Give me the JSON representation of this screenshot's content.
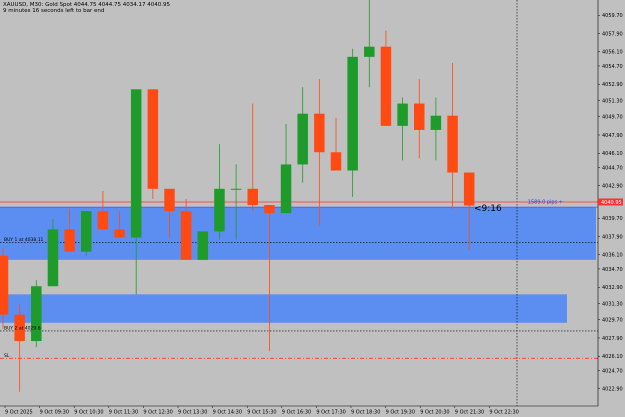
{
  "header": {
    "symbol_line": "XAUUSD, M30:  Gold Spot  4044.75  4044.75  4034.17  4040.95",
    "timer_line": "9 minutes 16 seconds left to bar end"
  },
  "colors": {
    "background": "#c0c0c0",
    "bull": "#1e9b2a",
    "bear": "#ff4a14",
    "zone": "#5b8ef0",
    "bid_line": "#ff3030",
    "blue_line": "#1e3cff",
    "grid": "#000000"
  },
  "price_axis": {
    "min": 4021.2,
    "max": 4061.2,
    "ticks": [
      "4059.70",
      "4056.10",
      "4052.90",
      "4049.70",
      "4046.10",
      "4042.90",
      "4039.70",
      "4036.10",
      "4032.90",
      "4029.70",
      "4026.10",
      "4022.90"
    ],
    "ticks_mid": [
      "4057.90",
      "4054.70",
      "4051.30",
      "4047.90",
      "4044.70",
      "4041.30",
      "4037.90",
      "4034.70",
      "4031.30",
      "4027.90",
      "4024.70"
    ]
  },
  "price_labels": [
    "4059.70",
    "4057.90",
    "4056.10",
    "4054.70",
    "4052.90",
    "4051.30",
    "4049.70",
    "4047.90",
    "4046.10",
    "4044.70",
    "4042.90",
    "4041.30",
    "4039.70",
    "4037.90",
    "4036.10",
    "4034.70",
    "4032.90",
    "4031.30",
    "4029.70",
    "4027.90",
    "4026.10",
    "4024.70",
    "4022.90"
  ],
  "time_axis": {
    "labels": [
      "9 Oct 2025",
      "9 Oct 09:30",
      "9 Oct 10:30",
      "9 Oct 11:30",
      "9 Oct 12:30",
      "9 Oct 13:30",
      "9 Oct 14:30",
      "9 Oct 15:30",
      "9 Oct 16:30",
      "9 Oct 17:30",
      "9 Oct 18:30",
      "9 Oct 19:30",
      "9 Oct 20:30",
      "9 Oct 21:30",
      "9 Oct 22:30"
    ]
  },
  "chart_data": {
    "type": "candlestick",
    "candles": [
      {
        "o": 4036.0,
        "h": 4036.8,
        "l": 4028.8,
        "c": 4030.2
      },
      {
        "o": 4030.2,
        "h": 4031.2,
        "l": 4022.6,
        "c": 4027.6
      },
      {
        "o": 4027.6,
        "h": 4033.6,
        "l": 4027.0,
        "c": 4033.0
      },
      {
        "o": 4033.0,
        "h": 4039.6,
        "l": 4033.0,
        "c": 4038.6
      },
      {
        "o": 4038.6,
        "h": 4040.6,
        "l": 4036.4,
        "c": 4036.4
      },
      {
        "o": 4036.4,
        "h": 4040.4,
        "l": 4036.0,
        "c": 4040.4
      },
      {
        "o": 4040.4,
        "h": 4042.4,
        "l": 4038.6,
        "c": 4038.6
      },
      {
        "o": 4038.6,
        "h": 4040.4,
        "l": 4037.8,
        "c": 4037.8
      },
      {
        "o": 4037.8,
        "h": 4048.6,
        "l": 4032.2,
        "c": 4052.4
      },
      {
        "o": 4052.4,
        "h": 4052.4,
        "l": 4041.6,
        "c": 4042.6
      },
      {
        "o": 4042.6,
        "h": 4042.6,
        "l": 4037.8,
        "c": 4040.4
      },
      {
        "o": 4040.4,
        "h": 4041.6,
        "l": 4035.6,
        "c": 4035.6
      },
      {
        "o": 4035.6,
        "h": 4035.6,
        "l": 4035.6,
        "c": 4038.4
      },
      {
        "o": 4038.4,
        "h": 4047.0,
        "l": 4037.6,
        "c": 4042.6
      },
      {
        "o": 4042.6,
        "h": 4045.0,
        "l": 4037.6,
        "c": 4042.6
      },
      {
        "o": 4042.6,
        "h": 4051.0,
        "l": 4040.4,
        "c": 4041.0
      },
      {
        "o": 4041.0,
        "h": 4041.0,
        "l": 4026.6,
        "c": 4040.2
      },
      {
        "o": 4040.2,
        "h": 4049.0,
        "l": 4040.2,
        "c": 4045.0
      },
      {
        "o": 4045.0,
        "h": 4052.6,
        "l": 4043.2,
        "c": 4050.0
      },
      {
        "o": 4050.0,
        "h": 4053.4,
        "l": 4039.0,
        "c": 4046.2
      },
      {
        "o": 4046.2,
        "h": 4049.6,
        "l": 4044.4,
        "c": 4044.4
      },
      {
        "o": 4044.4,
        "h": 4056.4,
        "l": 4041.8,
        "c": 4055.6
      },
      {
        "o": 4055.6,
        "h": 4061.6,
        "l": 4052.6,
        "c": 4056.6
      },
      {
        "o": 4056.6,
        "h": 4058.2,
        "l": 4048.8,
        "c": 4048.8
      },
      {
        "o": 4048.8,
        "h": 4051.6,
        "l": 4045.4,
        "c": 4051.0
      },
      {
        "o": 4051.0,
        "h": 4053.4,
        "l": 4045.6,
        "c": 4048.4
      },
      {
        "o": 4048.4,
        "h": 4051.6,
        "l": 4045.4,
        "c": 4049.8
      },
      {
        "o": 4049.8,
        "h": 4055.0,
        "l": 4040.6,
        "c": 4044.2
      },
      {
        "o": 4044.2,
        "h": 4044.2,
        "l": 4036.6,
        "c": 4040.95
      }
    ],
    "zones": [
      {
        "top": 4040.8,
        "bottom": 4035.6,
        "until": "9 Oct 22:30"
      },
      {
        "top": 4032.2,
        "bottom": 4029.4,
        "until": "9 Oct 22:30"
      }
    ],
    "lines": {
      "bid": 4041.3,
      "bid2": 4040.8,
      "buy1": 4037.3,
      "buy2": 4028.6,
      "sl": 4025.9,
      "vertical_time": "9 Oct 22:30"
    }
  },
  "labels": {
    "buy1": "BUY 1 at 4038.11",
    "buy2": "BUY 2 at 4029.6",
    "sl": "SL",
    "bid_tag": "1589.0 pips +",
    "price_box": "4040.95",
    "countdown": "<9:16"
  }
}
